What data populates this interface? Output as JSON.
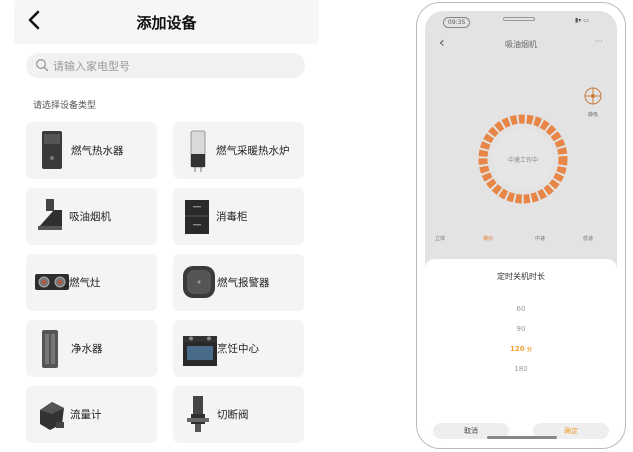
{
  "header": {
    "title": "添加设备"
  },
  "search": {
    "placeholder": "请输入家电型号"
  },
  "section_hint": "请选择设备类型",
  "devices": [
    {
      "label": "燃气热水器",
      "icon": "gas-water-heater-icon"
    },
    {
      "label": "燃气采暖热水炉",
      "icon": "gas-boiler-icon"
    },
    {
      "label": "吸油烟机",
      "icon": "range-hood-icon"
    },
    {
      "label": "消毒柜",
      "icon": "disinfection-cabinet-icon"
    },
    {
      "label": "燃气灶",
      "icon": "gas-stove-icon"
    },
    {
      "label": "燃气报警器",
      "icon": "gas-alarm-icon"
    },
    {
      "label": "净水器",
      "icon": "water-purifier-icon"
    },
    {
      "label": "烹饪中心",
      "icon": "cooking-center-icon"
    },
    {
      "label": "流量计",
      "icon": "flow-meter-icon"
    },
    {
      "label": "切断阀",
      "icon": "shutoff-valve-icon"
    }
  ],
  "phone": {
    "status_time": "09:35",
    "title": "吸油烟机",
    "more": "···",
    "fan_label": "静吸",
    "dial_text": "中速工作中",
    "modes": [
      "立体",
      "爆炒",
      "中速",
      "低速"
    ],
    "sheet": {
      "title": "定时关机时长",
      "options": [
        "60",
        "90",
        "120",
        "180"
      ],
      "selected_index": 2,
      "selected_suffix": "分",
      "cancel_label": "取消",
      "confirm_label": "确定"
    }
  },
  "colors": {
    "accent": "#f0a030",
    "card_bg": "#f4f4f4",
    "dial_ring": "#e8762a"
  }
}
